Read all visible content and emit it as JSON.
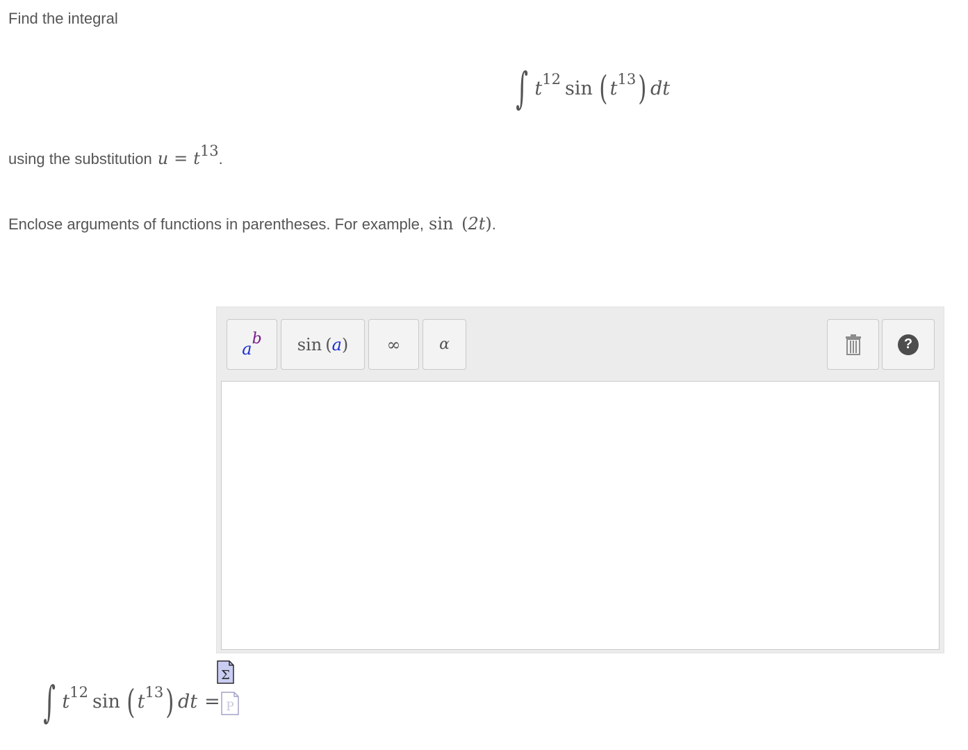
{
  "prompt": {
    "line1": "Find the integral",
    "line2_prefix": "using the substitution",
    "line3_prefix": "Enclose arguments of functions in parentheses. For example,"
  },
  "equation": {
    "integral_sign": "∫",
    "t": "t",
    "exp12": "12",
    "sin": "sin",
    "exp13": "13",
    "lparen": "(",
    "rparen": ")",
    "dt": "dt",
    "equals": "=",
    "u": "u",
    "period": "."
  },
  "example": {
    "func": "sin",
    "open": "(",
    "arg": "2t",
    "close": ")",
    "period": "."
  },
  "toolbar": {
    "power_base": "a",
    "power_exp": "b",
    "func_name": "sin",
    "func_open": "(",
    "func_arg": "a",
    "func_close": ")",
    "infinity": "∞",
    "greek": "α",
    "help": "?"
  },
  "answer": {
    "value": ""
  },
  "colors": {
    "power_base": "#1b2fcf",
    "power_exp": "#7a1a8c",
    "func_arg": "#1b2fcf",
    "help_bg": "#4d4d4d",
    "sigma_icon_bg": "#c9cdf2"
  },
  "icons": [
    "trash-icon",
    "help-icon",
    "sigma-formula-icon",
    "preview-page-icon"
  ]
}
